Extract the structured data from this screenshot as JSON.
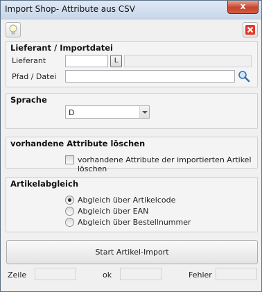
{
  "window": {
    "title": "Import Shop- Attribute aus CSV",
    "close_label": "x"
  },
  "toolbar": {
    "tip_icon": "lightbulb-icon",
    "close_icon": "red-x-icon"
  },
  "lieferant_group": {
    "title": "Lieferant / Importdatei",
    "lieferant_label": "Lieferant",
    "lieferant_value": "",
    "lookup_button": "L",
    "lieferant_name": "",
    "path_label": "Pfad / Datei",
    "path_value": "",
    "browse_icon": "magnifier-icon"
  },
  "sprache_group": {
    "title": "Sprache",
    "selected": "D"
  },
  "delete_group": {
    "title": "vorhandene Attribute löschen",
    "checkbox_label": "vorhandene Attribute der importierten Artikel löschen",
    "checked": false
  },
  "abgleich_group": {
    "title": "Artikelabgleich",
    "options": [
      {
        "label": "Abgleich über Artikelcode",
        "checked": true
      },
      {
        "label": "Abgleich über EAN",
        "checked": false
      },
      {
        "label": "Abgleich über Bestellnummer",
        "checked": false
      }
    ]
  },
  "start_button": "Start Artikel-Import",
  "status": {
    "zeile_label": "Zeile",
    "zeile_value": "",
    "ok_label": "ok",
    "ok_value": "",
    "fehler_label": "Fehler",
    "fehler_value": ""
  }
}
